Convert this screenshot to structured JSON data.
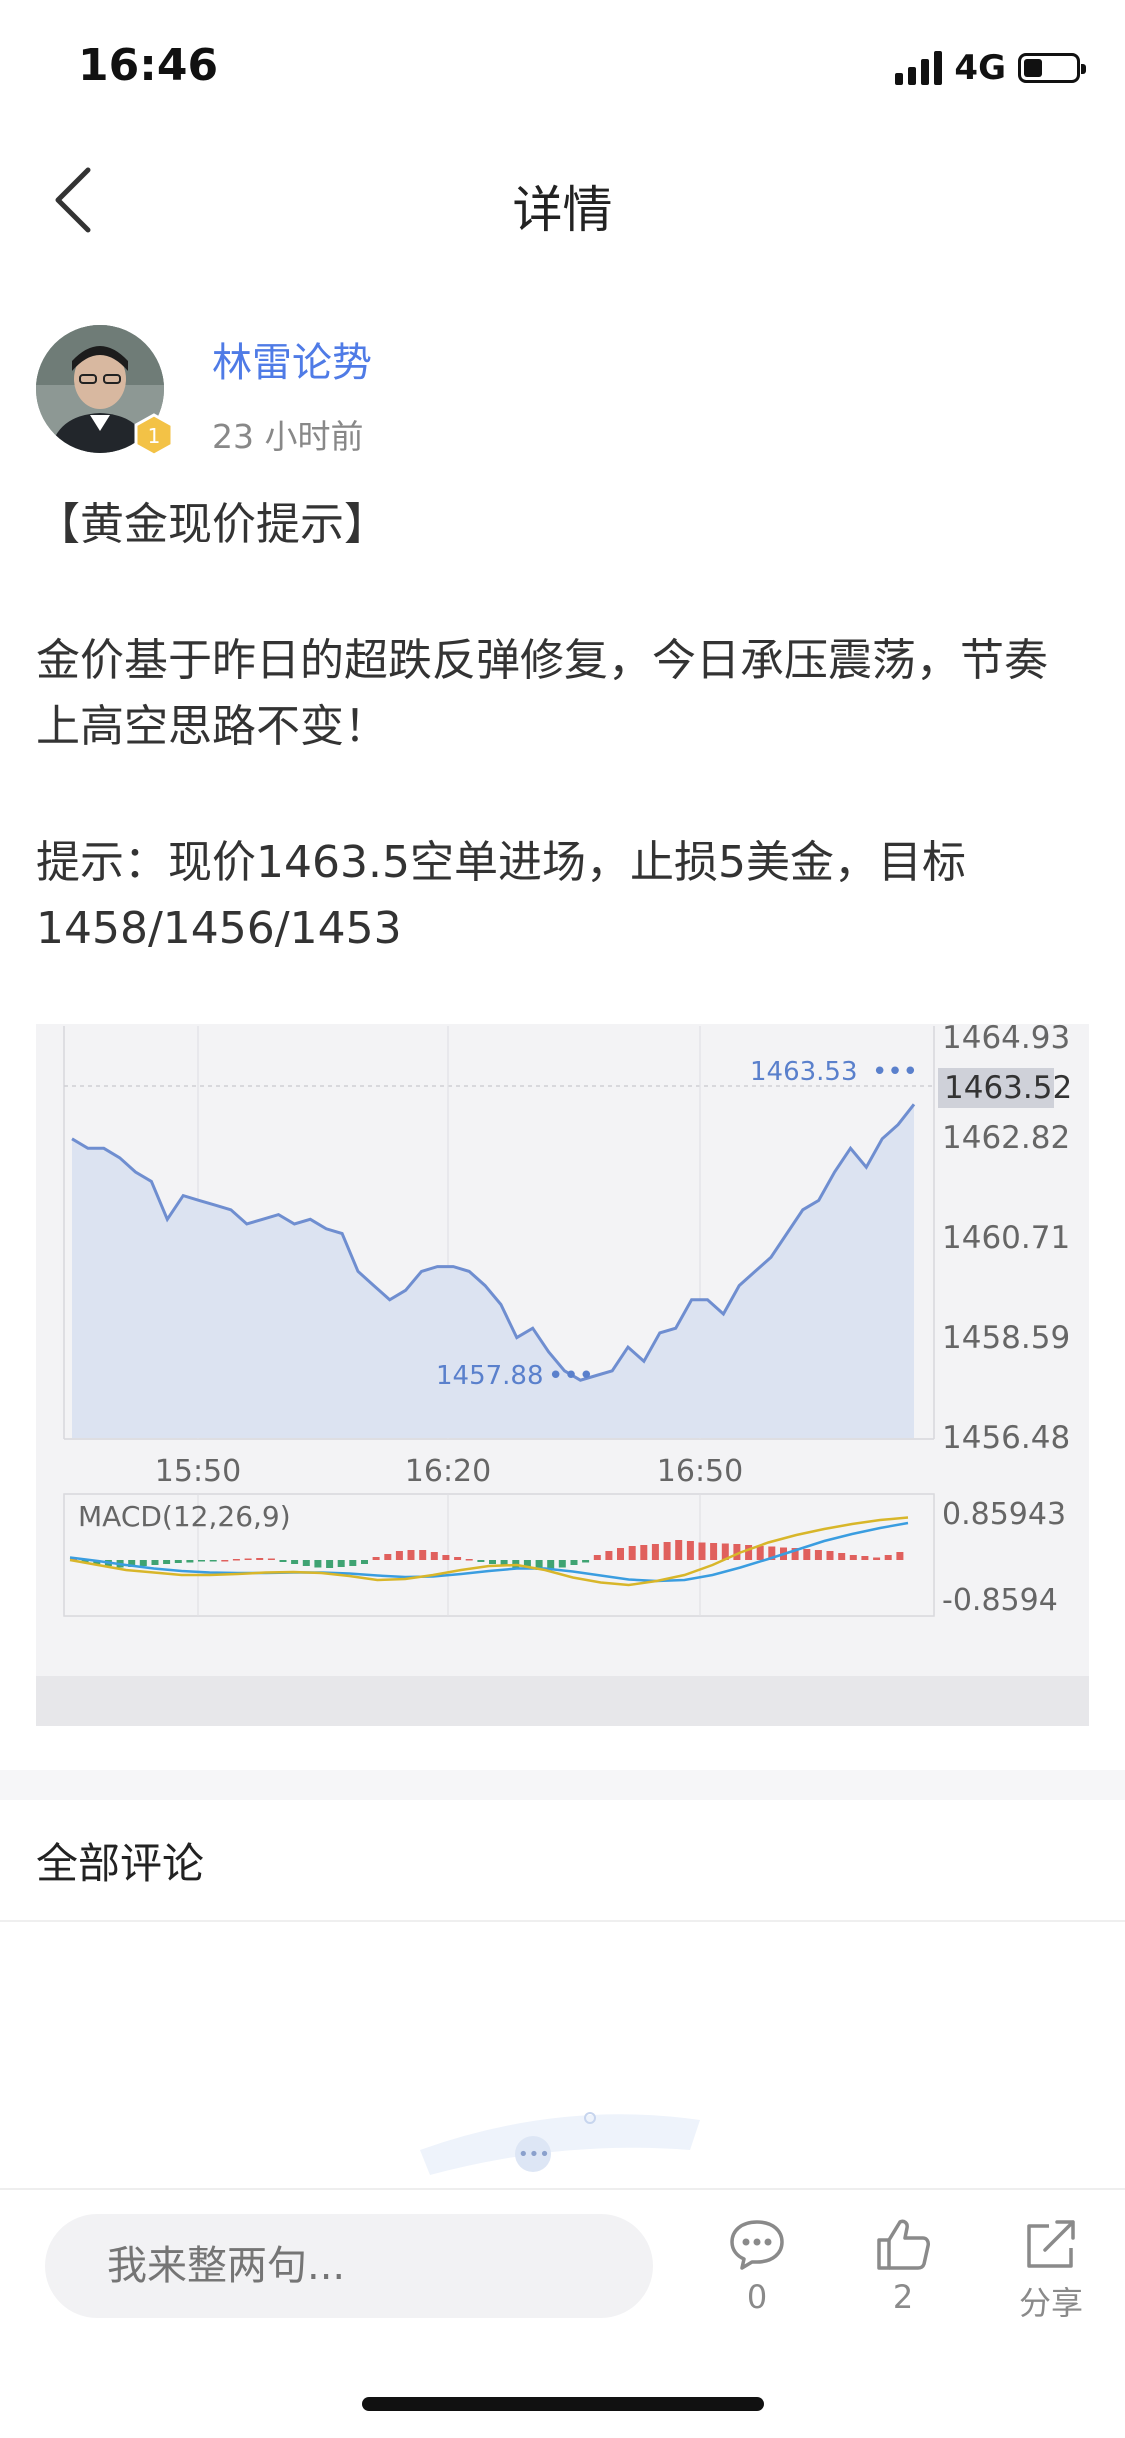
{
  "status_bar": {
    "time": "16:46",
    "network": "4G",
    "battery_level": 0.35
  },
  "nav": {
    "title": "详情",
    "back_icon": "chevron-left-icon"
  },
  "author": {
    "name": "林雷论势",
    "time_ago": "23 小时前",
    "badge": "1"
  },
  "post": {
    "title": "【黄金现价提示】",
    "paragraph1": "金价基于昨日的超跌反弹修复，今日承压震荡，节奏上高空思路不变！",
    "paragraph2": "提示：现价1463.5空单进场，止损5美金，目标1458/1456/1453"
  },
  "chart_data": [
    {
      "type": "line",
      "x_ticks": [
        "15:50",
        "16:20",
        "16:50"
      ],
      "y_ticks": [
        "1464.93",
        "1462.82",
        "1460.71",
        "1458.59",
        "1456.48"
      ],
      "ylim": [
        1456.48,
        1464.93
      ],
      "current_price_label": "1463.52",
      "max_label": "1463.53",
      "min_label": "1457.88",
      "series": [
        {
          "values": [
            1462.8,
            1462.6,
            1462.6,
            1462.4,
            1462.1,
            1461.9,
            1461.1,
            1461.6,
            1461.5,
            1461.4,
            1461.3,
            1461.0,
            1461.1,
            1461.2,
            1461.0,
            1461.1,
            1460.9,
            1460.8,
            1460.0,
            1459.7,
            1459.4,
            1459.6,
            1460.0,
            1460.1,
            1460.1,
            1460.0,
            1459.7,
            1459.3,
            1458.6,
            1458.8,
            1458.3,
            1457.9,
            1457.7,
            1457.8,
            1457.9,
            1458.4,
            1458.1,
            1458.7,
            1458.8,
            1459.4,
            1459.4,
            1459.1,
            1459.7,
            1460.0,
            1460.3,
            1460.8,
            1461.3,
            1461.5,
            1462.1,
            1462.6,
            1462.2,
            1462.8,
            1463.1,
            1463.53
          ]
        }
      ]
    },
    {
      "type": "bar",
      "title": "MACD(12,26,9)",
      "y_ticks": [
        "0.85943",
        "-0.8594"
      ],
      "ylim": [
        -0.8594,
        0.85943
      ],
      "colors": {
        "up": "#e0605d",
        "down": "#3fa372",
        "dif": "#d8b62a",
        "dea": "#3a9de0"
      },
      "histogram": [
        0.05,
        -0.05,
        -0.08,
        -0.12,
        -0.15,
        -0.14,
        -0.12,
        -0.1,
        -0.08,
        -0.06,
        -0.05,
        -0.03,
        -0.02,
        0.0,
        0.02,
        0.03,
        0.04,
        0.03,
        -0.04,
        -0.08,
        -0.12,
        -0.15,
        -0.16,
        -0.14,
        -0.12,
        -0.08,
        0.06,
        0.12,
        0.18,
        0.2,
        0.2,
        0.16,
        0.1,
        0.06,
        0.02,
        -0.04,
        -0.08,
        -0.12,
        -0.16,
        -0.18,
        -0.2,
        -0.18,
        -0.15,
        -0.1,
        -0.05,
        0.1,
        0.18,
        0.24,
        0.28,
        0.3,
        0.32,
        0.36,
        0.4,
        0.38,
        0.35,
        0.34,
        0.33,
        0.32,
        0.3,
        0.28,
        0.27,
        0.25,
        0.24,
        0.22,
        0.2,
        0.18,
        0.14,
        0.1,
        0.08,
        0.05,
        0.1,
        0.16
      ],
      "dif": [
        0.0,
        -0.1,
        -0.2,
        -0.25,
        -0.3,
        -0.3,
        -0.28,
        -0.25,
        -0.24,
        -0.26,
        -0.32,
        -0.4,
        -0.38,
        -0.3,
        -0.2,
        -0.12,
        -0.1,
        -0.2,
        -0.35,
        -0.45,
        -0.5,
        -0.42,
        -0.3,
        -0.1,
        0.15,
        0.35,
        0.5,
        0.62,
        0.72,
        0.8,
        0.85
      ],
      "dea": [
        0.05,
        -0.02,
        -0.1,
        -0.17,
        -0.22,
        -0.25,
        -0.26,
        -0.26,
        -0.25,
        -0.25,
        -0.27,
        -0.31,
        -0.34,
        -0.33,
        -0.28,
        -0.22,
        -0.17,
        -0.17,
        -0.23,
        -0.31,
        -0.39,
        -0.42,
        -0.4,
        -0.3,
        -0.15,
        0.02,
        0.2,
        0.38,
        0.52,
        0.64,
        0.74
      ]
    }
  ],
  "comments": {
    "title": "全部评论"
  },
  "bottom_bar": {
    "input_placeholder": "我来整两句...",
    "comment_count": "0",
    "like_count": "2",
    "share_label": "分享"
  }
}
